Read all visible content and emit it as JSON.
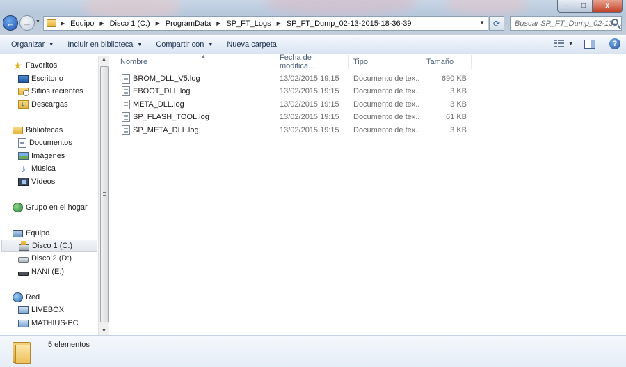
{
  "window": {
    "controls": {
      "minimize": "–",
      "maximize": "□",
      "close": "x"
    }
  },
  "address_bar": {
    "crumbs": [
      "Equipo",
      "Disco 1 (C:)",
      "ProgramData",
      "SP_FT_Logs",
      "SP_FT_Dump_02-13-2015-18-36-39"
    ],
    "search_placeholder": "Buscar SP_FT_Dump_02-13-..."
  },
  "toolbar": {
    "organize": "Organizar",
    "include_library": "Incluir en biblioteca",
    "share": "Compartir con",
    "new_folder": "Nueva carpeta"
  },
  "sidebar": {
    "favorites": {
      "label": "Favoritos",
      "items": [
        "Escritorio",
        "Sitios recientes",
        "Descargas"
      ]
    },
    "libraries": {
      "label": "Bibliotecas",
      "items": [
        "Documentos",
        "Imágenes",
        "Música",
        "Vídeos"
      ]
    },
    "homegroup": {
      "label": "Grupo en el hogar"
    },
    "computer": {
      "label": "Equipo",
      "items": [
        "Disco 1 (C:)",
        "Disco 2 (D:)",
        "NANI (E:)"
      ]
    },
    "network": {
      "label": "Red",
      "items": [
        "LIVEBOX",
        "MATHIUS-PC"
      ]
    }
  },
  "columns": {
    "name": "Nombre",
    "date": "Fecha de modifica...",
    "type": "Tipo",
    "size": "Tamaño"
  },
  "files": [
    {
      "name": "BROM_DLL_V5.log",
      "date": "13/02/2015 19:15",
      "type": "Documento de tex...",
      "size": "690 KB"
    },
    {
      "name": "EBOOT_DLL.log",
      "date": "13/02/2015 19:15",
      "type": "Documento de tex...",
      "size": "3 KB"
    },
    {
      "name": "META_DLL.log",
      "date": "13/02/2015 19:15",
      "type": "Documento de tex...",
      "size": "3 KB"
    },
    {
      "name": "SP_FLASH_TOOL.log",
      "date": "13/02/2015 19:15",
      "type": "Documento de tex...",
      "size": "61 KB"
    },
    {
      "name": "SP_META_DLL.log",
      "date": "13/02/2015 19:15",
      "type": "Documento de tex...",
      "size": "3 KB"
    }
  ],
  "status": {
    "item_count": "5 elementos"
  }
}
